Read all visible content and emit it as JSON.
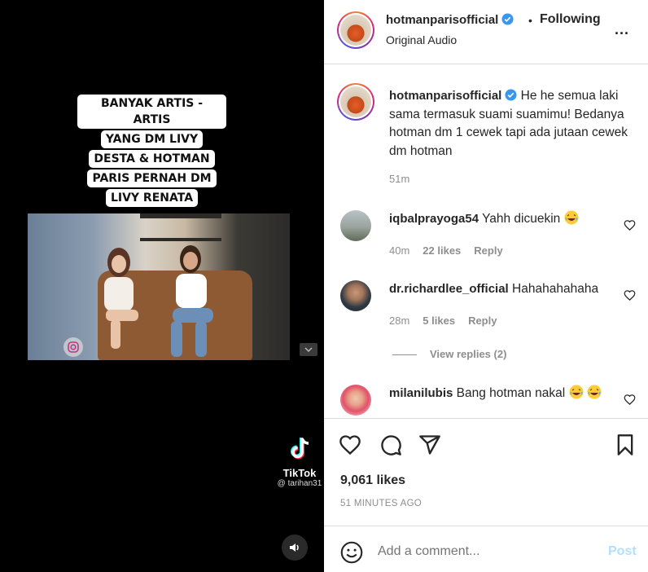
{
  "video": {
    "caption_lines": [
      "BANYAK ARTIS - ARTIS",
      "YANG DM LIVY",
      "DESTA & HOTMAN",
      "PARIS PERNAH DM",
      "LIVY RENATA"
    ],
    "tiktok_name": "TikTok",
    "tiktok_handle": "@ tarihan31",
    "icons": {
      "watermark": "instagram-icon",
      "pip": "chevron-down-icon",
      "mute": "speaker-icon",
      "tiktok": "tiktok-logo"
    }
  },
  "header": {
    "username": "hotmanparisofficial",
    "dot": "•",
    "following_label": "Following",
    "audio_label": "Original Audio",
    "more_label": "..."
  },
  "post": {
    "username": "hotmanparisofficial",
    "caption_text": "He he semua laki sama termasuk suami suamimu! Bedanya hotman dm 1 cewek tapi ada jutaan cewek dm hotman",
    "time": "51m"
  },
  "comments": [
    {
      "username": "iqbalprayoga54",
      "text": "Yahh dicuekin",
      "emoji": "laughing-emoji",
      "time": "40m",
      "likes": "22 likes",
      "reply_label": "Reply"
    },
    {
      "username": "dr.richardlee_official",
      "text": "Hahahahahaha",
      "time": "28m",
      "likes": "5 likes",
      "reply_label": "Reply"
    },
    {
      "username": "milanilubis",
      "text": "Bang hotman nakal",
      "emoji": "laughing-emoji"
    }
  ],
  "view_replies_label": "View replies (2)",
  "actions": {
    "icons": [
      "heart-icon",
      "comment-icon",
      "share-icon",
      "bookmark-icon"
    ],
    "likes_count": "9,061 likes",
    "post_age": "51 MINUTES AGO"
  },
  "composer": {
    "placeholder": "Add a comment...",
    "post_label": "Post"
  },
  "colors": {
    "verified": "#3897f0",
    "post_button": "#b2dffc",
    "muted_text": "#8e8e8e"
  }
}
